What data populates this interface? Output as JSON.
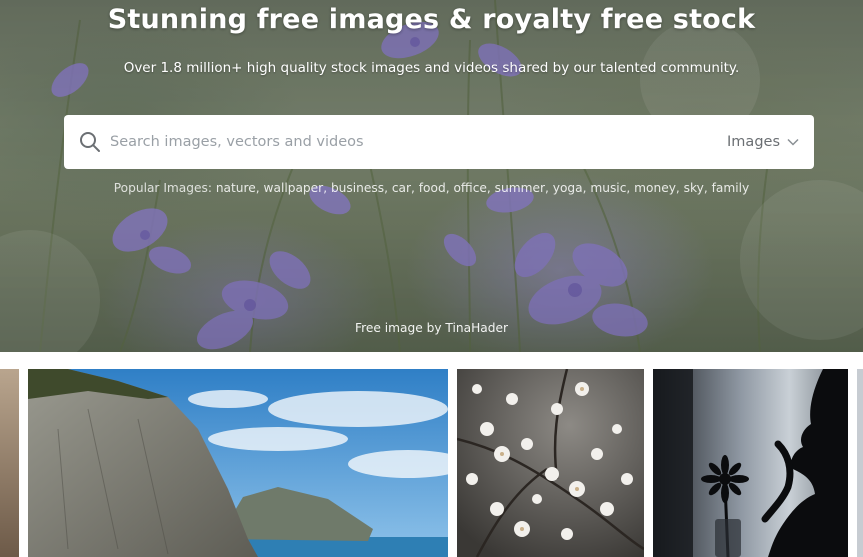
{
  "hero": {
    "title": "Stunning free images & royalty free stock",
    "subtitle": "Over 1.8 million+ high quality stock images and videos shared by our talented community.",
    "credit": "Free image by TinaHader"
  },
  "search": {
    "placeholder": "Search images, vectors and videos",
    "type_label": "Images",
    "icon": "search-icon"
  },
  "popular": {
    "label": "Popular Images:",
    "tags": [
      "nature",
      "wallpaper",
      "business",
      "car",
      "food",
      "office",
      "summer",
      "yoga",
      "music",
      "money",
      "sky",
      "family"
    ]
  },
  "gallery": {
    "images": [
      "cliff-coast",
      "white-blossoms",
      "silhouette-flower"
    ]
  },
  "colors": {
    "hero_overlay_text": "#ffffff",
    "search_bg": "#ffffff",
    "placeholder": "#9aa0a6"
  }
}
